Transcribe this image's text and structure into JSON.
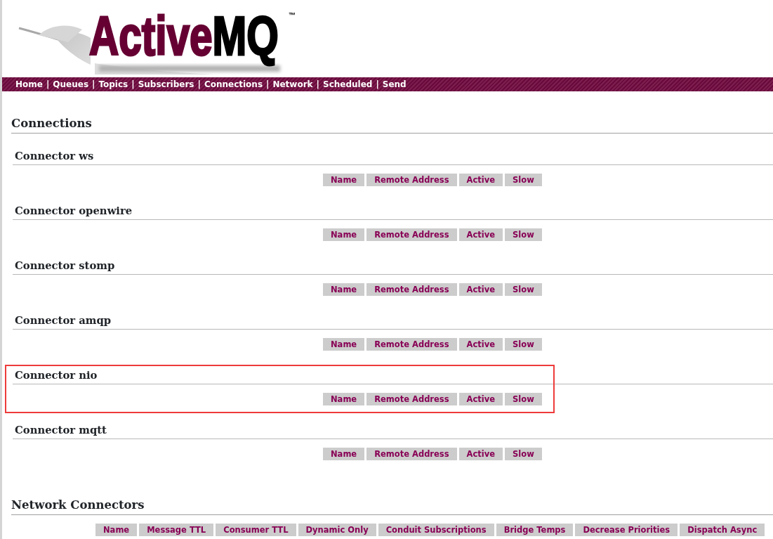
{
  "logo": {
    "parts": [
      {
        "text": "Active",
        "color": "#660033"
      },
      {
        "text": "MQ",
        "color": "#000000"
      }
    ],
    "trademark": "™"
  },
  "nav": [
    {
      "kind": "link",
      "text": "Home"
    },
    {
      "kind": "separator",
      "text": "|"
    },
    {
      "kind": "link",
      "text": "Queues"
    },
    {
      "kind": "separator",
      "text": "|"
    },
    {
      "kind": "link",
      "text": "Topics"
    },
    {
      "kind": "separator",
      "text": "|"
    },
    {
      "kind": "link",
      "text": "Subscribers"
    },
    {
      "kind": "separator",
      "text": "|"
    },
    {
      "kind": "link",
      "text": "Connections"
    },
    {
      "kind": "separator",
      "text": "|"
    },
    {
      "kind": "link",
      "text": "Network"
    },
    {
      "kind": "separator",
      "text": "|"
    },
    {
      "kind": "link",
      "text": "Scheduled"
    },
    {
      "kind": "separator",
      "text": "|"
    },
    {
      "kind": "link",
      "text": "Send"
    }
  ],
  "page_title": "Connections",
  "connectors": [
    {
      "title": "Connector ws",
      "highlighted": false,
      "columns": [
        "Name",
        "Remote Address",
        "Active",
        "Slow"
      ]
    },
    {
      "title": "Connector openwire",
      "highlighted": false,
      "columns": [
        "Name",
        "Remote Address",
        "Active",
        "Slow"
      ]
    },
    {
      "title": "Connector stomp",
      "highlighted": false,
      "columns": [
        "Name",
        "Remote Address",
        "Active",
        "Slow"
      ]
    },
    {
      "title": "Connector amqp",
      "highlighted": false,
      "columns": [
        "Name",
        "Remote Address",
        "Active",
        "Slow"
      ]
    },
    {
      "title": "Connector nio",
      "highlighted": true,
      "columns": [
        "Name",
        "Remote Address",
        "Active",
        "Slow"
      ]
    },
    {
      "title": "Connector mqtt",
      "highlighted": false,
      "columns": [
        "Name",
        "Remote Address",
        "Active",
        "Slow"
      ]
    }
  ],
  "network_connectors": {
    "title": "Network Connectors",
    "columns": [
      "Name",
      "Message TTL",
      "Consumer TTL",
      "Dynamic Only",
      "Conduit Subscriptions",
      "Bridge Temps",
      "Decrease Priorities",
      "Dispatch Async"
    ]
  }
}
